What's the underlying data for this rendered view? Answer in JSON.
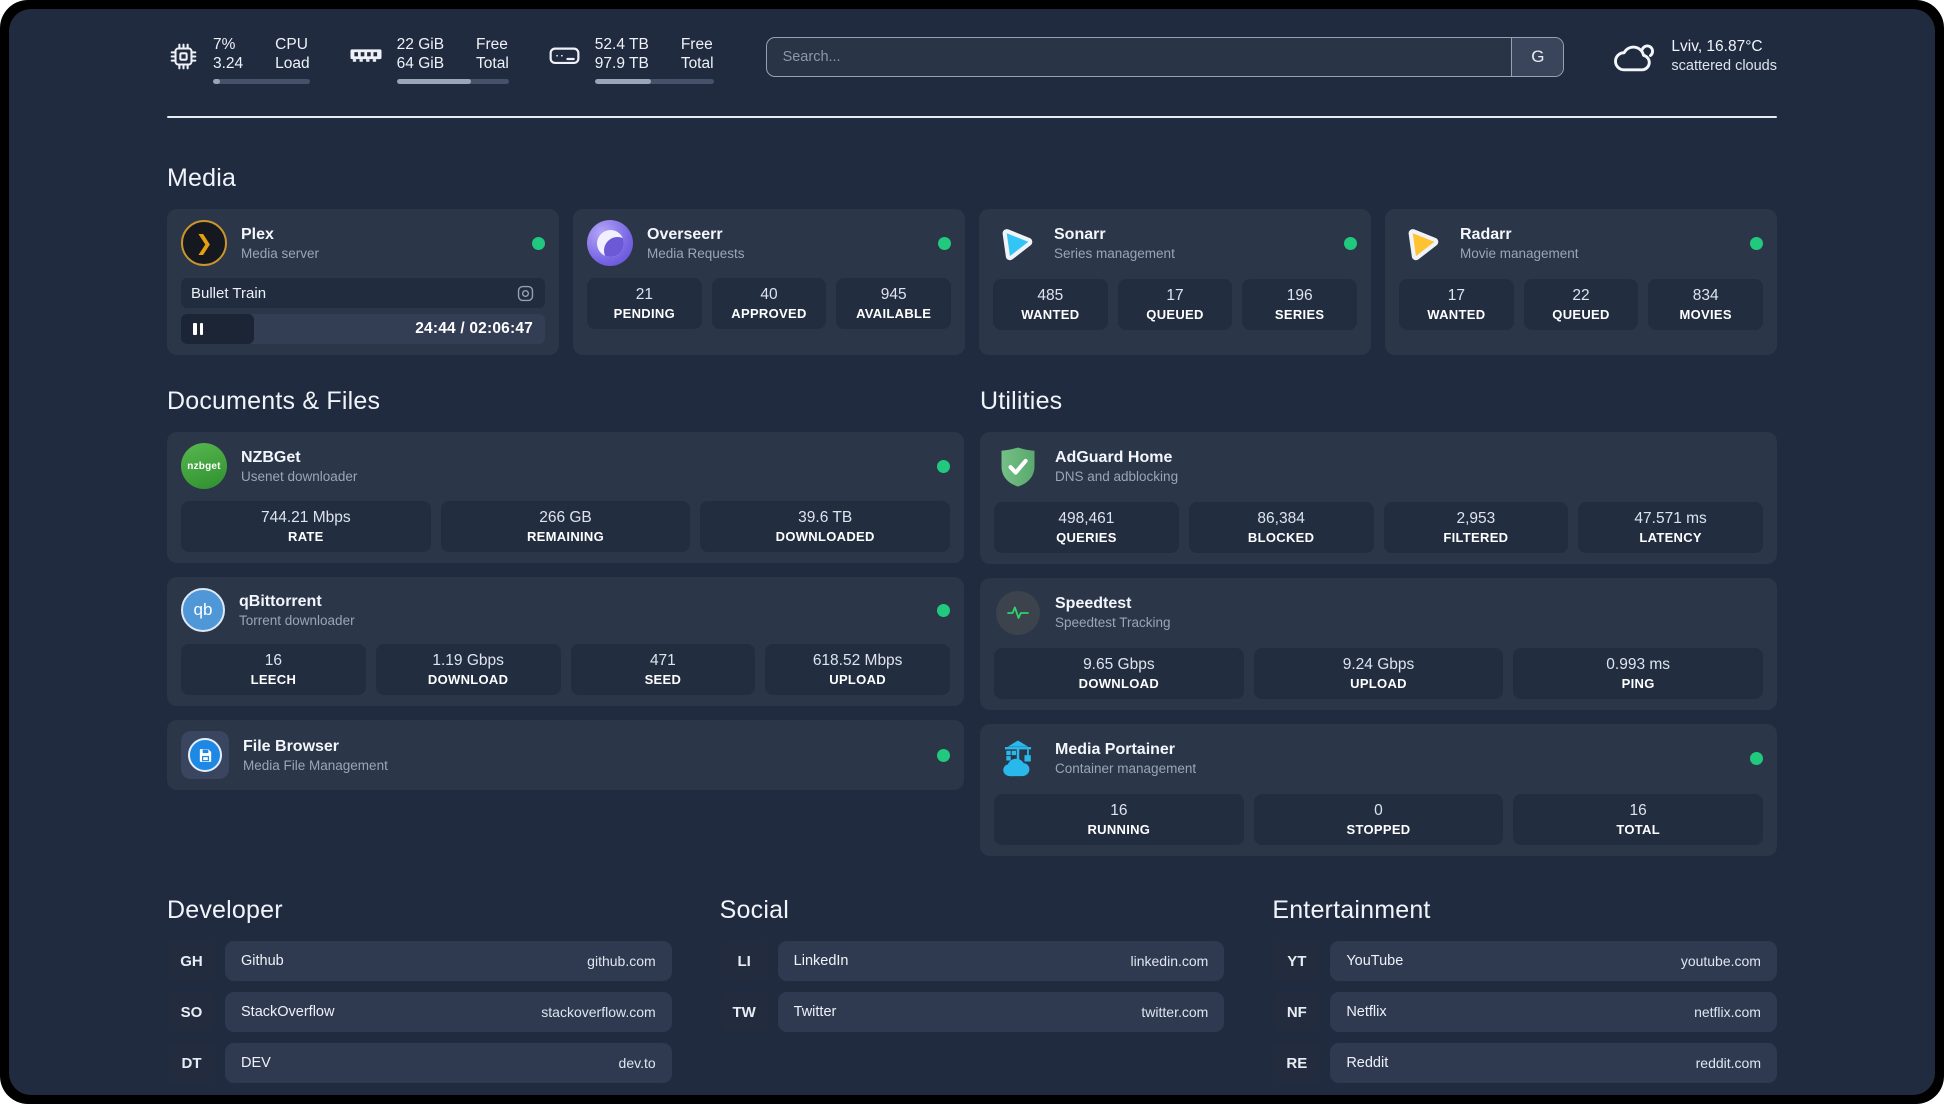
{
  "palette": {
    "status_online": "#21c97f",
    "plex": "#e5a00d",
    "overseerr": "#7b6ce0",
    "sonarr": "#35c5f4",
    "radarr": "#ffc230",
    "nzbget": "#3da639",
    "qbittorrent": "#4f97d6",
    "filebrowser": "#1e88e5",
    "adguard": "#67b97a",
    "speedtest": "#2dd36f",
    "portainer": "#29b8eb"
  },
  "topbar": {
    "cpu": {
      "usage": "7%",
      "load": "3.24",
      "label_top": "CPU",
      "label_bottom": "Load",
      "progress_percent": 7
    },
    "memory": {
      "free": "22 GiB",
      "total": "64 GiB",
      "label_top": "Free",
      "label_bottom": "Total",
      "progress_percent": 66
    },
    "disk": {
      "free": "52.4 TB",
      "total": "97.9 TB",
      "label_top": "Free",
      "label_bottom": "Total",
      "progress_percent": 47
    },
    "search": {
      "placeholder": "Search...",
      "engine_button": "G"
    },
    "weather": {
      "location": "Lviv, 16.87°C",
      "condition": "scattered clouds"
    }
  },
  "sections": {
    "media": {
      "title": "Media",
      "cards": [
        {
          "name": "Plex",
          "description": "Media server",
          "online": true,
          "icon_glyph": "❯",
          "player": {
            "title": "Bullet Train",
            "time": "24:44 / 02:06:47",
            "progress_percent": 20
          }
        },
        {
          "name": "Overseerr",
          "description": "Media Requests",
          "online": true,
          "stats": [
            {
              "value": "21",
              "label": "PENDING"
            },
            {
              "value": "40",
              "label": "APPROVED"
            },
            {
              "value": "945",
              "label": "AVAILABLE"
            }
          ]
        },
        {
          "name": "Sonarr",
          "description": "Series management",
          "online": true,
          "stats": [
            {
              "value": "485",
              "label": "WANTED"
            },
            {
              "value": "17",
              "label": "QUEUED"
            },
            {
              "value": "196",
              "label": "SERIES"
            }
          ]
        },
        {
          "name": "Radarr",
          "description": "Movie management",
          "online": true,
          "stats": [
            {
              "value": "17",
              "label": "WANTED"
            },
            {
              "value": "22",
              "label": "QUEUED"
            },
            {
              "value": "834",
              "label": "MOVIES"
            }
          ]
        }
      ]
    },
    "documents": {
      "title": "Documents & Files",
      "cards": [
        {
          "name": "NZBGet",
          "description": "Usenet downloader",
          "online": true,
          "icon_glyph": "nzbget",
          "stats": [
            {
              "value": "744.21 Mbps",
              "label": "RATE"
            },
            {
              "value": "266 GB",
              "label": "REMAINING"
            },
            {
              "value": "39.6 TB",
              "label": "DOWNLOADED"
            }
          ]
        },
        {
          "name": "qBittorrent",
          "description": "Torrent downloader",
          "online": true,
          "icon_glyph": "qb",
          "stats": [
            {
              "value": "16",
              "label": "LEECH"
            },
            {
              "value": "1.19 Gbps",
              "label": "DOWNLOAD"
            },
            {
              "value": "471",
              "label": "SEED"
            },
            {
              "value": "618.52 Mbps",
              "label": "UPLOAD"
            }
          ]
        },
        {
          "name": "File Browser",
          "description": "Media File Management",
          "online": true
        }
      ]
    },
    "utilities": {
      "title": "Utilities",
      "cards": [
        {
          "name": "AdGuard Home",
          "description": "DNS and adblocking",
          "stats": [
            {
              "value": "498,461",
              "label": "QUERIES"
            },
            {
              "value": "86,384",
              "label": "BLOCKED"
            },
            {
              "value": "2,953",
              "label": "FILTERED"
            },
            {
              "value": "47.571 ms",
              "label": "LATENCY"
            }
          ]
        },
        {
          "name": "Speedtest",
          "description": "Speedtest Tracking",
          "stats": [
            {
              "value": "9.65 Gbps",
              "label": "DOWNLOAD"
            },
            {
              "value": "9.24 Gbps",
              "label": "UPLOAD"
            },
            {
              "value": "0.993 ms",
              "label": "PING"
            }
          ]
        },
        {
          "name": "Media Portainer",
          "description": "Container management",
          "online": true,
          "stats": [
            {
              "value": "16",
              "label": "RUNNING"
            },
            {
              "value": "0",
              "label": "STOPPED"
            },
            {
              "value": "16",
              "label": "TOTAL"
            }
          ]
        }
      ]
    },
    "bookmarks": [
      {
        "title": "Developer",
        "links": [
          {
            "abbr": "GH",
            "name": "Github",
            "url": "github.com"
          },
          {
            "abbr": "SO",
            "name": "StackOverflow",
            "url": "stackoverflow.com"
          },
          {
            "abbr": "DT",
            "name": "DEV",
            "url": "dev.to"
          }
        ]
      },
      {
        "title": "Social",
        "links": [
          {
            "abbr": "LI",
            "name": "LinkedIn",
            "url": "linkedin.com"
          },
          {
            "abbr": "TW",
            "name": "Twitter",
            "url": "twitter.com"
          }
        ]
      },
      {
        "title": "Entertainment",
        "links": [
          {
            "abbr": "YT",
            "name": "YouTube",
            "url": "youtube.com"
          },
          {
            "abbr": "NF",
            "name": "Netflix",
            "url": "netflix.com"
          },
          {
            "abbr": "RE",
            "name": "Reddit",
            "url": "reddit.com"
          }
        ]
      }
    ]
  }
}
